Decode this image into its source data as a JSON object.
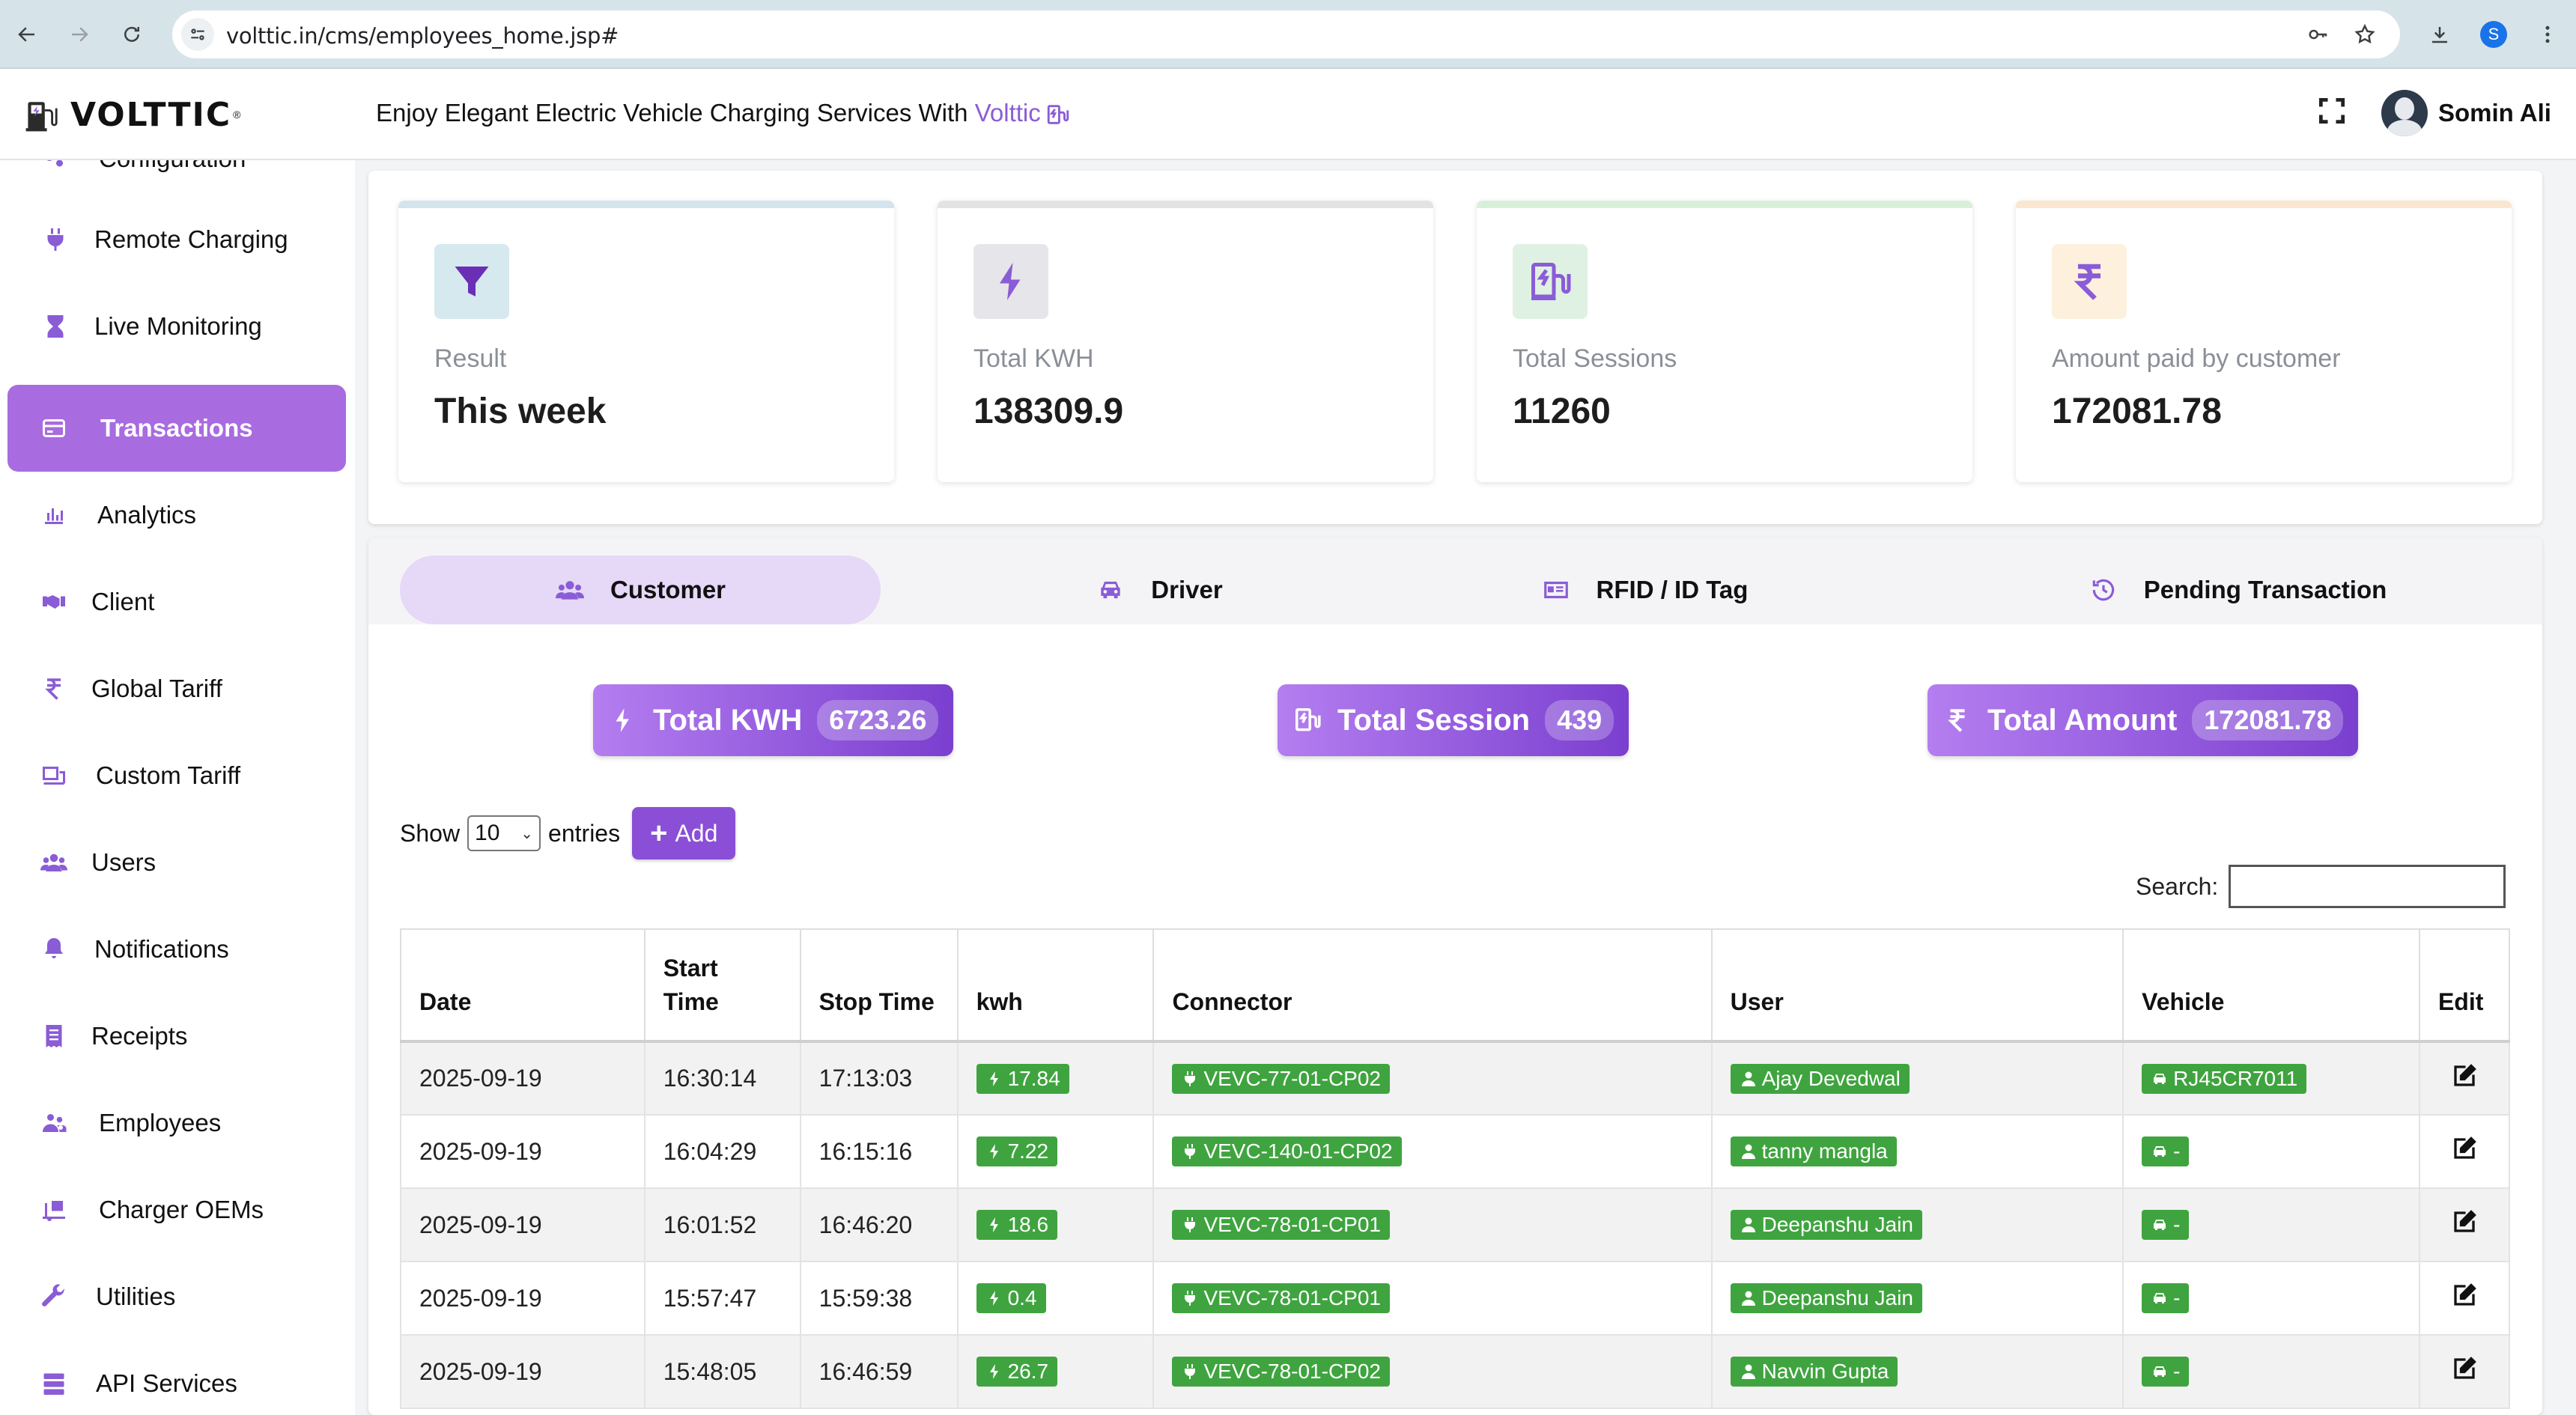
{
  "browser": {
    "url": "volttic.in/cms/employees_home.jsp#",
    "profile_initial": "S"
  },
  "header": {
    "logo_text": "VOLTTIC",
    "logo_reg": "®",
    "tagline_prefix": "Enjoy Elegant Electric Vehicle Charging Services With ",
    "tagline_brand": "Volttic",
    "user_name": "Somin Ali"
  },
  "sidebar": {
    "items": [
      {
        "label": "Configuration",
        "icon": "gears-icon"
      },
      {
        "label": "Remote Charging",
        "icon": "plug-icon"
      },
      {
        "label": "Live Monitoring",
        "icon": "hourglass-icon"
      },
      {
        "label": "Transactions",
        "icon": "credit-card-icon",
        "active": true
      },
      {
        "label": "Analytics",
        "icon": "bar-chart-icon"
      },
      {
        "label": "Client",
        "icon": "handshake-icon"
      },
      {
        "label": "Global Tariff",
        "icon": "rupee-icon"
      },
      {
        "label": "Custom Tariff",
        "icon": "tariff-icon"
      },
      {
        "label": "Users",
        "icon": "users-icon"
      },
      {
        "label": "Notifications",
        "icon": "bell-icon"
      },
      {
        "label": "Receipts",
        "icon": "receipt-icon"
      },
      {
        "label": "Employees",
        "icon": "employees-icon"
      },
      {
        "label": "Charger OEMs",
        "icon": "truck-loading-icon"
      },
      {
        "label": "Utilities",
        "icon": "wrench-icon"
      },
      {
        "label": "API Services",
        "icon": "server-icon"
      }
    ]
  },
  "stats": {
    "cards": [
      {
        "label": "Result",
        "value": "This week",
        "icon": "filter-icon",
        "accent": "#cfe3ec",
        "icon_bg": "#d6e9ef",
        "icon_color": "#6b2fb5"
      },
      {
        "label": "Total KWH",
        "value": "138309.9",
        "icon": "bolt-icon",
        "accent": "#e3e3e3",
        "icon_bg": "#e5e5ea",
        "icon_color": "#8a5cd6"
      },
      {
        "label": "Total Sessions",
        "value": "11260",
        "icon": "ev-station-icon",
        "accent": "#d8f0d8",
        "icon_bg": "#dff1e2",
        "icon_color": "#8a5cd6"
      },
      {
        "label": "Amount paid by customer",
        "value": "172081.78",
        "icon": "rupee-icon",
        "accent": "#fbe6cf",
        "icon_bg": "#fdf0dd",
        "icon_color": "#8a5cd6"
      }
    ]
  },
  "tabs": [
    {
      "label": "Customer",
      "icon": "users-icon",
      "active": true
    },
    {
      "label": "Driver",
      "icon": "car-icon"
    },
    {
      "label": "RFID / ID Tag",
      "icon": "id-card-icon"
    },
    {
      "label": "Pending Transaction",
      "icon": "history-icon"
    }
  ],
  "summary": {
    "kwh_label": "Total KWH",
    "kwh_value": "6723.26",
    "session_label": "Total Session",
    "session_value": "439",
    "amount_label": "Total Amount",
    "amount_value": "172081.78"
  },
  "controls": {
    "show_label": "Show",
    "entries_value": "10",
    "entries_label": "entries",
    "add_label": "Add",
    "search_label": "Search:",
    "search_value": ""
  },
  "table": {
    "columns": [
      "Date",
      "Start Time",
      "Stop Time",
      "kwh",
      "Connector",
      "User",
      "Vehicle",
      "Edit"
    ],
    "rows": [
      {
        "date": "2025-09-19",
        "start": "16:30:14",
        "stop": "17:13:03",
        "kwh": "17.84",
        "connector": "VEVC-77-01-CP02",
        "user": "Ajay Devedwal",
        "vehicle": "RJ45CR7011"
      },
      {
        "date": "2025-09-19",
        "start": "16:04:29",
        "stop": "16:15:16",
        "kwh": "7.22",
        "connector": "VEVC-140-01-CP02",
        "user": "tanny mangla",
        "vehicle": "-"
      },
      {
        "date": "2025-09-19",
        "start": "16:01:52",
        "stop": "16:46:20",
        "kwh": "18.6",
        "connector": "VEVC-78-01-CP01",
        "user": "Deepanshu Jain",
        "vehicle": "-"
      },
      {
        "date": "2025-09-19",
        "start": "15:57:47",
        "stop": "15:59:38",
        "kwh": "0.4",
        "connector": "VEVC-78-01-CP01",
        "user": "Deepanshu Jain",
        "vehicle": "-"
      },
      {
        "date": "2025-09-19",
        "start": "15:48:05",
        "stop": "16:46:59",
        "kwh": "26.7",
        "connector": "VEVC-78-01-CP02",
        "user": "Navvin Gupta",
        "vehicle": "-"
      }
    ]
  },
  "colors": {
    "accent": "#8a5cd6",
    "active_sidebar": "#a86be0",
    "tag_green": "#3fa43f"
  }
}
